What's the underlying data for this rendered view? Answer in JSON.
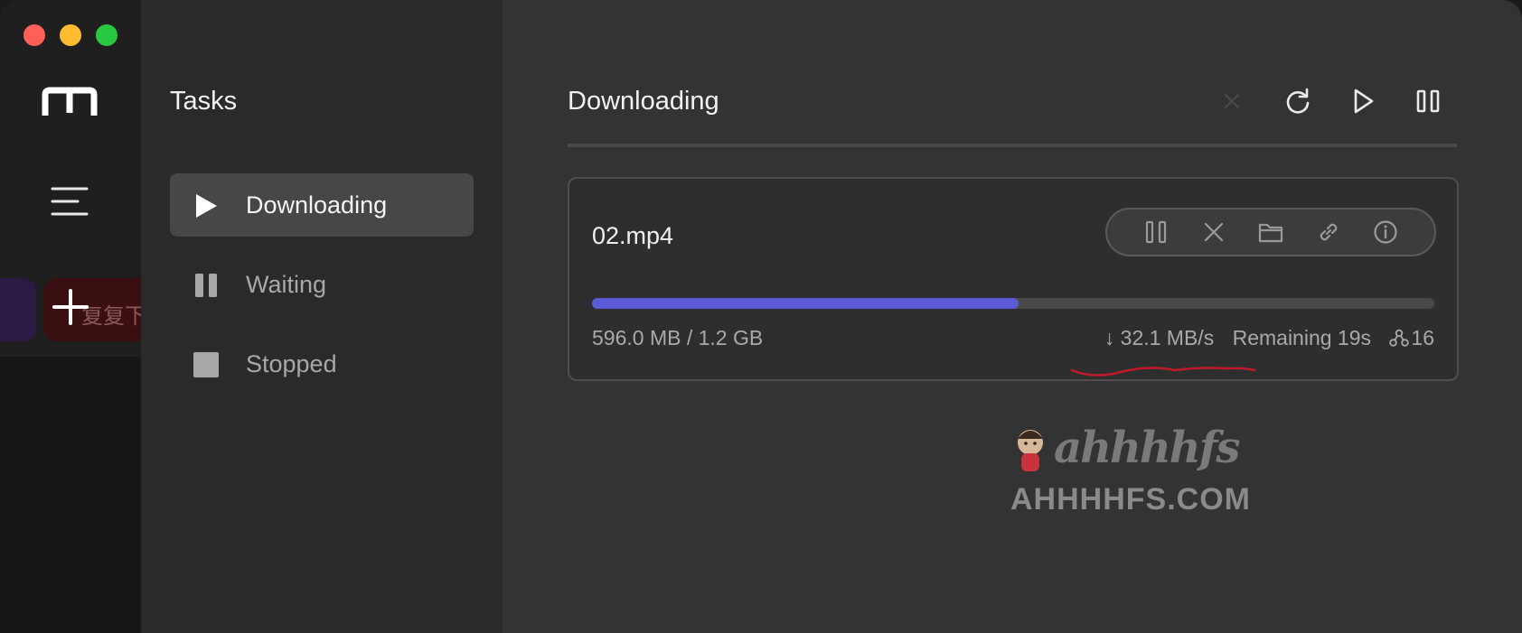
{
  "window": {
    "traffic_lights": [
      "close",
      "minimize",
      "zoom"
    ],
    "colors": {
      "close": "#fe5f57",
      "minimize": "#febc2e",
      "zoom": "#28c840"
    }
  },
  "rail": {
    "logo_icon": "motrix-logo-icon",
    "menu_icon": "hamburger-menu-icon",
    "add_icon": "plus-icon",
    "background_app_text": "复复下"
  },
  "sidebar": {
    "title": "Tasks",
    "items": [
      {
        "label": "Downloading",
        "icon": "play-icon",
        "active": true
      },
      {
        "label": "Waiting",
        "icon": "pause-icon",
        "active": false
      },
      {
        "label": "Stopped",
        "icon": "stop-icon",
        "active": false
      }
    ]
  },
  "main": {
    "title": "Downloading",
    "toolbar": [
      "clear-icon",
      "refresh-icon",
      "resume-all-icon",
      "pause-all-icon"
    ]
  },
  "task": {
    "name": "02.mp4",
    "actions": [
      "pause-icon",
      "delete-icon",
      "folder-icon",
      "link-icon",
      "info-icon"
    ],
    "progress": 0.506,
    "progress_color": "#5b5bd8",
    "size": "596.0 MB / 1.2 GB",
    "speed": "↓ 32.1 MB/s",
    "remaining": "Remaining 19s",
    "connections": "16"
  },
  "watermark": {
    "script": "ahhhhfs",
    "domain": "AHHHHFS.COM"
  }
}
